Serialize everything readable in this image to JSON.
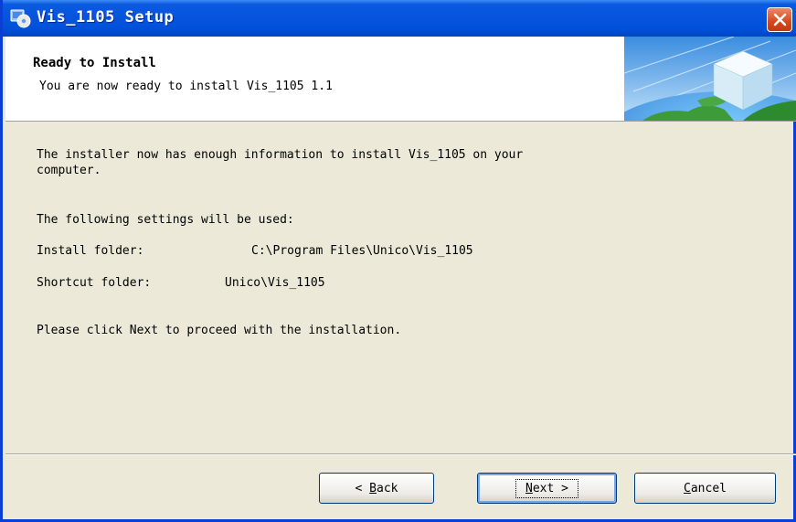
{
  "window": {
    "title": "Vis_1105 Setup"
  },
  "header": {
    "title": "Ready to Install",
    "subtitle": "You are now ready to install Vis_1105 1.1"
  },
  "body": {
    "intro_line1": "The installer now has enough information to install Vis_1105 on your",
    "intro_line2": "computer.",
    "settings_heading": "The following settings will be used:",
    "install_folder_label": "Install folder:",
    "install_folder_value": "C:\\Program Files\\Unico\\Vis_1105",
    "shortcut_folder_label": "Shortcut folder:",
    "shortcut_folder_value": "Unico\\Vis_1105",
    "proceed_text": "Please click Next to proceed with the installation."
  },
  "buttons": {
    "back_prefix": "< ",
    "back_key": "B",
    "back_rest": "ack",
    "next_key": "N",
    "next_rest": "ext >",
    "cancel_key": "C",
    "cancel_rest": "ancel"
  },
  "colors": {
    "titlebar": "#0654de",
    "dialog_bg": "#ece9d8",
    "close_button": "#d4481d"
  },
  "icons": [
    "setup-app-icon",
    "close-icon",
    "globe-cube-graphic"
  ]
}
